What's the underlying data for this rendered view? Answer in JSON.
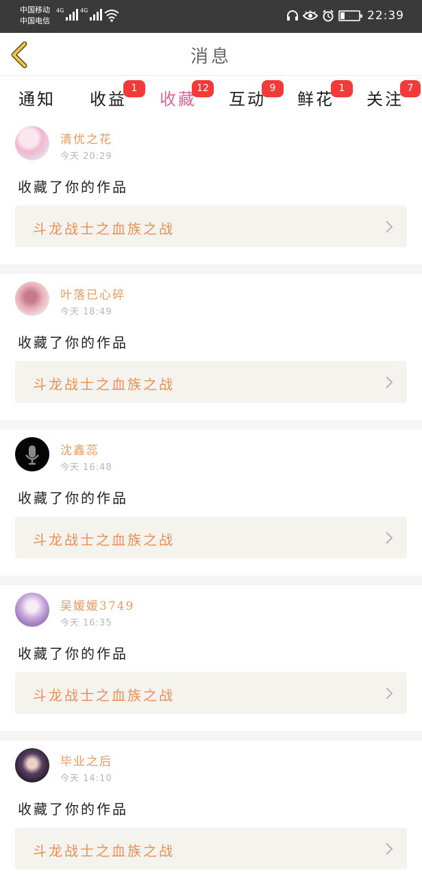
{
  "status_bar": {
    "carrier1": "中国移动",
    "carrier2": "中国电信",
    "net1": "4G",
    "net2": "4G",
    "battery": "42",
    "time": "22:39"
  },
  "header": {
    "title": "消息"
  },
  "tabs": [
    {
      "label": "通知",
      "badge": ""
    },
    {
      "label": "收益",
      "badge": "1"
    },
    {
      "label": "收藏",
      "badge": "12"
    },
    {
      "label": "互动",
      "badge": "9"
    },
    {
      "label": "鲜花",
      "badge": "1"
    },
    {
      "label": "关注",
      "badge": "7"
    }
  ],
  "active_tab": "收藏",
  "messages": [
    {
      "user": "清优之花",
      "time": "今天 20:29",
      "action": "收藏了你的作品",
      "work": "斗龙战士之血族之战"
    },
    {
      "user": "叶落已心碎",
      "time": "今天 18:49",
      "action": "收藏了你的作品",
      "work": "斗龙战士之血族之战"
    },
    {
      "user": "沈鑫蕊",
      "time": "今天 16:48",
      "action": "收藏了你的作品",
      "work": "斗龙战士之血族之战"
    },
    {
      "user": "吴媛媛3749",
      "time": "今天 16:35",
      "action": "收藏了你的作品",
      "work": "斗龙战士之血族之战"
    },
    {
      "user": "毕业之后",
      "time": "今天 14:10",
      "action": "收藏了你的作品",
      "work": "斗龙战士之血族之战"
    }
  ],
  "icons": {
    "back": "chevron-left-icon",
    "chevron": "chevron-right-icon",
    "status": [
      "headset-icon",
      "eye-icon",
      "alarm-icon",
      "wifi-icon",
      "signal-icon",
      "battery-icon"
    ]
  },
  "colors": {
    "accent": "#d7679a",
    "badge": "#f23a3a",
    "username": "#ea9a5f",
    "work_title": "#ec8f56",
    "back_arrow": "#f2c94c"
  }
}
